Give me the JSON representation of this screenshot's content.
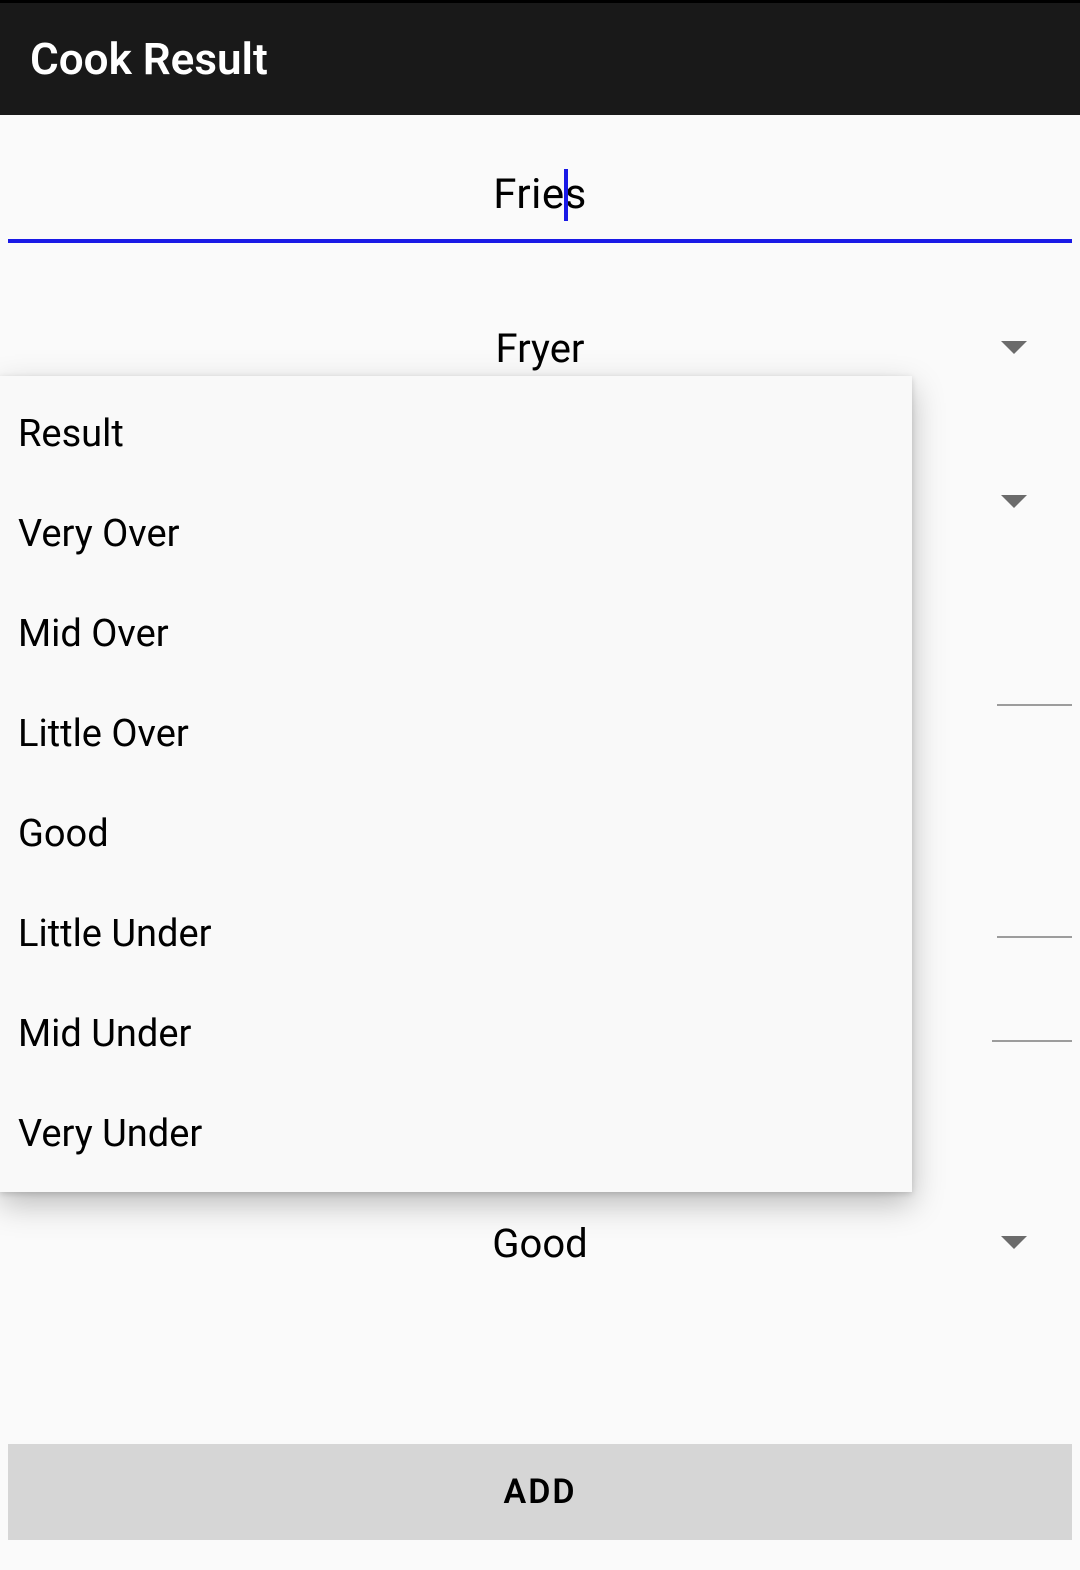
{
  "header": {
    "title": "Cook Result"
  },
  "form": {
    "food_name_value": "Fries",
    "method_value": "Fryer",
    "result_value": "Good"
  },
  "dropdown": {
    "items": [
      "Result",
      "Very Over",
      "Mid Over",
      "Little Over",
      "Good",
      "Little Under",
      "Mid Under",
      "Very Under"
    ]
  },
  "buttons": {
    "add_label": "ADD"
  }
}
